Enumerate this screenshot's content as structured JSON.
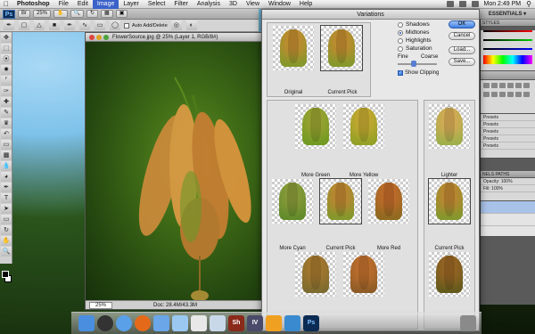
{
  "menubar": {
    "app_name": "Photoshop",
    "items": [
      "File",
      "Edit",
      "Image",
      "Layer",
      "Select",
      "Filter",
      "Analysis",
      "3D",
      "View",
      "Window",
      "Help"
    ],
    "active_item": "Image",
    "clock": "Mon 2:49 PM"
  },
  "toolbar": {
    "zoom_value": "25%",
    "workspace": "ESSENTIALS ▾"
  },
  "options_bar": {
    "auto_add_delete": "Auto Add/Delete"
  },
  "document": {
    "title": "FlowerSource.jpg @ 25% (Layer 1, RGB/8#)",
    "zoom": "25%",
    "doc_info": "Doc: 28.4M/43.3M"
  },
  "variations": {
    "title": "Variations",
    "original_label": "Original",
    "current_pick_label": "Current Pick",
    "options": [
      {
        "label": "Shadows",
        "selected": false
      },
      {
        "label": "Midtones",
        "selected": true
      },
      {
        "label": "Highlights",
        "selected": false
      },
      {
        "label": "Saturation",
        "selected": false
      }
    ],
    "fine_label": "Fine",
    "coarse_label": "Coarse",
    "show_clipping_label": "Show Clipping",
    "show_clipping": true,
    "buttons": {
      "ok": "OK",
      "cancel": "Cancel",
      "load": "Load...",
      "save": "Save..."
    },
    "grid_labels": {
      "more_green": "More Green",
      "more_yellow": "More Yellow",
      "more_cyan": "More Cyan",
      "current_pick": "Current Pick",
      "more_red": "More Red",
      "lighter": "Lighter",
      "current_pick_right": "Current Pick"
    }
  },
  "panels": {
    "styles_tab": "STYLES",
    "presets": [
      "Presets",
      "Presets",
      "Presets",
      "Presets",
      "Presets"
    ],
    "layers_tabs": "NELS   PATHS",
    "opacity_label": "Opacity:",
    "opacity_value": "100%",
    "fill_label": "Fill:",
    "fill_value": "100%"
  },
  "dock": {
    "items": [
      "Finder",
      "Dashboard",
      "Safari",
      "Firefox",
      "iTunes",
      "Preview",
      "iPhoto",
      "Mail",
      "Sh",
      "IV",
      "Pages",
      "Flash",
      "Ps",
      "Trash"
    ]
  },
  "colors": {
    "menu_active": "#3a62c9",
    "ok_button": "#3f7fe0",
    "dialog_bg": "#e8e8e8"
  }
}
